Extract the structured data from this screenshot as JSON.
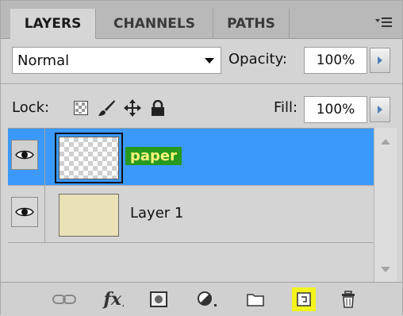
{
  "tabs": [
    {
      "label": "LAYERS",
      "active": true
    },
    {
      "label": "CHANNELS",
      "active": false
    },
    {
      "label": "PATHS",
      "active": false
    }
  ],
  "blend_mode": {
    "selected": "Normal"
  },
  "opacity": {
    "label": "Opacity:",
    "value": "100%"
  },
  "lock": {
    "label": "Lock:"
  },
  "fill": {
    "label": "Fill:",
    "value": "100%"
  },
  "layers": [
    {
      "name": "paper",
      "selected": true,
      "visible": true,
      "thumbnail": "transparent"
    },
    {
      "name": "Layer 1",
      "selected": false,
      "visible": true,
      "thumbnail": "tan-fill"
    }
  ],
  "colors": {
    "selection": "#3b99fc",
    "name_highlight_bg": "#279a1e",
    "name_highlight_text": "#fff37a",
    "toolbar_highlight": "#f3f31d"
  },
  "toolbar": {
    "fx_label": "fx",
    "icons": [
      "link-layers-icon",
      "layer-style-icon",
      "layer-mask-icon",
      "adjustment-layer-icon",
      "new-group-icon",
      "new-layer-icon",
      "delete-layer-icon"
    ]
  }
}
